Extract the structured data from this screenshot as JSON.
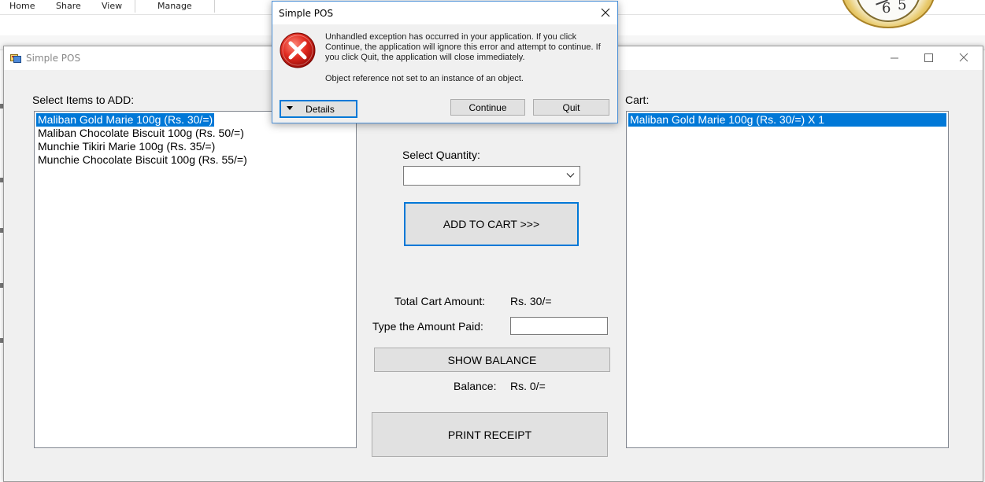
{
  "ribbon": {
    "tabs": [
      "Home",
      "Share",
      "View",
      "Manage"
    ]
  },
  "clock": {
    "numbers": [
      "6",
      "5"
    ]
  },
  "window": {
    "title": "Simple POS",
    "left_label": "Select Items to ADD:",
    "items": [
      "Maliban Gold Marie 100g (Rs. 30/=)",
      "Maliban Chocolate Biscuit 100g (Rs. 50/=)",
      "Munchie Tikiri Marie 100g (Rs. 35/=)",
      "Munchie Chocolate Biscuit 100g (Rs. 55/=)"
    ],
    "selected_item_index": 0,
    "quantity_label": "Select Quantity:",
    "quantity_value": "",
    "add_button": "ADD TO CART >>>",
    "total_label": "Total Cart Amount:",
    "total_value": "Rs. 30/=",
    "paid_label": "Type the Amount Paid:",
    "paid_value": "",
    "show_balance_button": "SHOW BALANCE",
    "balance_label": "Balance:",
    "balance_value": "Rs. 0/=",
    "print_button": "PRINT RECEIPT",
    "cart_label": "Cart:",
    "cart_items": [
      "Maliban Gold Marie 100g (Rs. 30/=) X 1"
    ],
    "colors": {
      "selection": "#0078d7",
      "window_bg": "#f0f0f0"
    }
  },
  "dialog": {
    "title": "Simple POS",
    "message_lines": [
      "Unhandled exception has occurred in your application. If you click",
      "Continue, the application will ignore this error and attempt to continue. If",
      "you click Quit, the application will close immediately."
    ],
    "error_detail": "Object reference not set to an instance of an object.",
    "details_button": "Details",
    "continue_button": "Continue",
    "quit_button": "Quit",
    "icon": "error-icon"
  }
}
